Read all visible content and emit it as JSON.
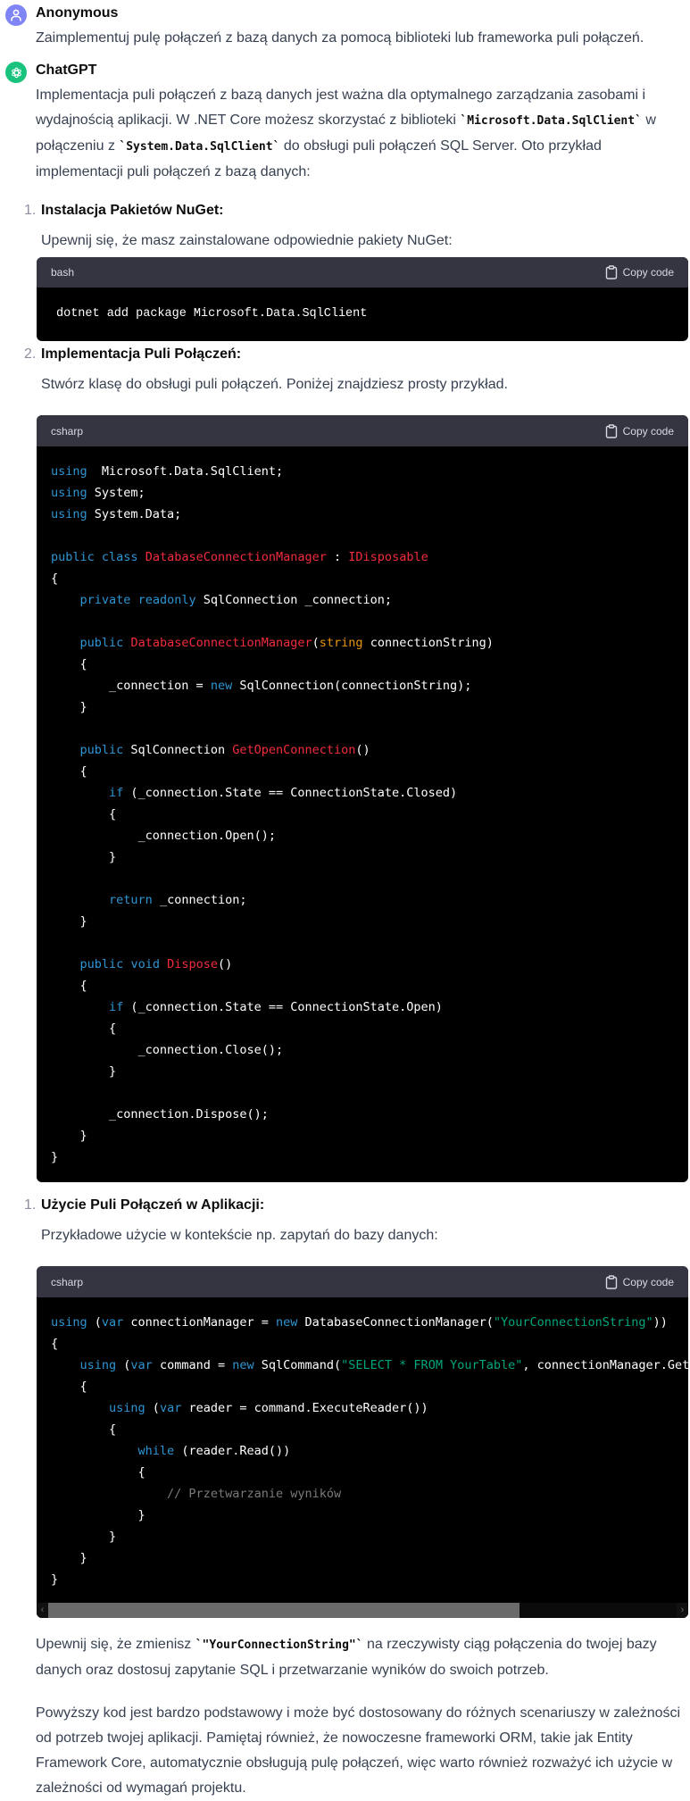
{
  "user_message": {
    "author": "Anonymous",
    "avatar_icon": "user-icon",
    "text": "Zaimplementuj pulę połączeń z bazą danych za pomocą biblioteki lub frameworka puli połączeń."
  },
  "assistant_message": {
    "author": "ChatGPT",
    "avatar_icon": "openai-logo-icon",
    "intro": {
      "part1": "Implementacja puli połączeń z bazą danych jest ważna dla optymalnego zarządzania zasobami i wydajnością aplikacji. W .NET Core możesz skorzystać z biblioteki ",
      "code1": "`Microsoft.Data.SqlClient`",
      "part2": " w połączeniu z ",
      "code2": "`System.Data.SqlClient`",
      "part3": " do obsługi puli połączeń SQL Server. Oto przykład implementacji puli połączeń z bazą danych:"
    },
    "steps": [
      {
        "number": "1.",
        "title": "Instalacja Pakietów NuGet:",
        "description": "Upewnij się, że masz zainstalowane odpowiednie pakiety NuGet:",
        "code": {
          "language": "bash",
          "copy_label": "Copy code",
          "text": "dotnet add package Microsoft.Data.SqlClient"
        }
      },
      {
        "number": "2.",
        "title": "Implementacja Puli Połączeń:",
        "description": "Stwórz klasę do obsługi puli połączeń. Poniżej znajdziesz prosty przykład.",
        "code": {
          "language": "csharp",
          "copy_label": "Copy code"
        }
      },
      {
        "number": "1.",
        "title": "Użycie Puli Połączeń w Aplikacji:",
        "description": "Przykładowe użycie w kontekście np. zapytań do bazy danych:",
        "code": {
          "language": "csharp",
          "copy_label": "Copy code",
          "scroll_fraction_visible": 0.75,
          "scroll_position": 0
        }
      }
    ],
    "code_lines": {
      "block2": [
        [
          [
            "kw",
            "using"
          ],
          [
            "",
            "  Microsoft.Data.SqlClient;"
          ]
        ],
        [
          [
            "kw",
            "using"
          ],
          [
            "",
            " System;"
          ]
        ],
        [
          [
            "kw",
            "using"
          ],
          [
            "",
            " System.Data;"
          ]
        ],
        [],
        [
          [
            "kw",
            "public"
          ],
          [
            "",
            " "
          ],
          [
            "kw",
            "class"
          ],
          [
            "",
            " "
          ],
          [
            "ty",
            "DatabaseConnectionManager"
          ],
          [
            "",
            " : "
          ],
          [
            "ty",
            "IDisposable"
          ]
        ],
        [
          [
            "",
            "{"
          ]
        ],
        [
          [
            "",
            "    "
          ],
          [
            "kw",
            "private"
          ],
          [
            "",
            " "
          ],
          [
            "kw",
            "readonly"
          ],
          [
            "",
            " SqlConnection _connection;"
          ]
        ],
        [],
        [
          [
            "",
            "    "
          ],
          [
            "kw",
            "public"
          ],
          [
            "",
            " "
          ],
          [
            "ty",
            "DatabaseConnectionManager"
          ],
          [
            "",
            "("
          ],
          [
            "or",
            "string"
          ],
          [
            "",
            " connectionString)"
          ]
        ],
        [
          [
            "",
            "    {"
          ]
        ],
        [
          [
            "",
            "        _connection = "
          ],
          [
            "kw",
            "new"
          ],
          [
            "",
            " SqlConnection(connectionString);"
          ]
        ],
        [
          [
            "",
            "    }"
          ]
        ],
        [],
        [
          [
            "",
            "    "
          ],
          [
            "kw",
            "public"
          ],
          [
            "",
            " SqlConnection "
          ],
          [
            "ty",
            "GetOpenConnection"
          ],
          [
            "",
            "()"
          ]
        ],
        [
          [
            "",
            "    {"
          ]
        ],
        [
          [
            "",
            "        "
          ],
          [
            "kw",
            "if"
          ],
          [
            "",
            " (_connection.State == ConnectionState.Closed)"
          ]
        ],
        [
          [
            "",
            "        {"
          ]
        ],
        [
          [
            "",
            "            _connection.Open();"
          ]
        ],
        [
          [
            "",
            "        }"
          ]
        ],
        [],
        [
          [
            "",
            "        "
          ],
          [
            "kw",
            "return"
          ],
          [
            "",
            " _connection;"
          ]
        ],
        [
          [
            "",
            "    }"
          ]
        ],
        [],
        [
          [
            "",
            "    "
          ],
          [
            "kw",
            "public"
          ],
          [
            "",
            " "
          ],
          [
            "kw",
            "void"
          ],
          [
            "",
            " "
          ],
          [
            "ty",
            "Dispose"
          ],
          [
            "",
            "()"
          ]
        ],
        [
          [
            "",
            "    {"
          ]
        ],
        [
          [
            "",
            "        "
          ],
          [
            "kw",
            "if"
          ],
          [
            "",
            " (_connection.State == ConnectionState.Open)"
          ]
        ],
        [
          [
            "",
            "        {"
          ]
        ],
        [
          [
            "",
            "            _connection.Close();"
          ]
        ],
        [
          [
            "",
            "        }"
          ]
        ],
        [],
        [
          [
            "",
            "        _connection.Dispose();"
          ]
        ],
        [
          [
            "",
            "    }"
          ]
        ],
        [
          [
            "",
            "}"
          ]
        ]
      ],
      "block3": [
        [
          [
            "kw",
            "using"
          ],
          [
            "",
            " ("
          ],
          [
            "kw",
            "var"
          ],
          [
            "",
            " connectionManager = "
          ],
          [
            "kw",
            "new"
          ],
          [
            "",
            " DatabaseConnectionManager("
          ],
          [
            "st",
            "\"YourConnectionString\""
          ],
          [
            "",
            "))"
          ]
        ],
        [
          [
            "",
            "{"
          ]
        ],
        [
          [
            "",
            "    "
          ],
          [
            "kw",
            "using"
          ],
          [
            "",
            " ("
          ],
          [
            "kw",
            "var"
          ],
          [
            "",
            " command = "
          ],
          [
            "kw",
            "new"
          ],
          [
            "",
            " SqlCommand("
          ],
          [
            "st",
            "\"SELECT * FROM YourTable\""
          ],
          [
            "",
            ", connectionManager.GetOpenConnection()))"
          ]
        ],
        [
          [
            "",
            "    {"
          ]
        ],
        [
          [
            "",
            "        "
          ],
          [
            "kw",
            "using"
          ],
          [
            "",
            " ("
          ],
          [
            "kw",
            "var"
          ],
          [
            "",
            " reader = command.ExecuteReader())"
          ]
        ],
        [
          [
            "",
            "        {"
          ]
        ],
        [
          [
            "",
            "            "
          ],
          [
            "kw",
            "while"
          ],
          [
            "",
            " (reader.Read())"
          ]
        ],
        [
          [
            "",
            "            {"
          ]
        ],
        [
          [
            "",
            "                "
          ],
          [
            "cm",
            "// Przetwarzanie wyników"
          ]
        ],
        [
          [
            "",
            "            }"
          ]
        ],
        [
          [
            "",
            "        }"
          ]
        ],
        [
          [
            "",
            "    }"
          ]
        ],
        [
          [
            "",
            "}"
          ]
        ]
      ]
    },
    "outro": {
      "p1_part1": "Upewnij się, że zmienisz ",
      "p1_code": "`\"YourConnectionString\"`",
      "p1_part2": " na rzeczywisty ciąg połączenia do twojej bazy danych oraz dostosuj zapytanie SQL i przetwarzanie wyników do swoich potrzeb.",
      "p2": "Powyższy kod jest bardzo podstawowy i może być dostosowany do różnych scenariuszy w zależności od potrzeb twojej aplikacji. Pamiętaj również, że nowoczesne frameworki ORM, takie jak Entity Framework Core, automatycznie obsługują pulę połączeń, więc warto również rozważyć ich użycie w zależności od wymagań projektu."
    }
  },
  "colors": {
    "user_avatar": "#7f85f5",
    "gpt_avatar": "#19c37d",
    "keyword": "#2e95d3",
    "type_name": "#f22c3d",
    "string": "#00a67d",
    "builtin_type": "#e9950c",
    "comment": "#7a7a7a",
    "code_bg": "#000000",
    "code_header_bg": "#343541"
  }
}
